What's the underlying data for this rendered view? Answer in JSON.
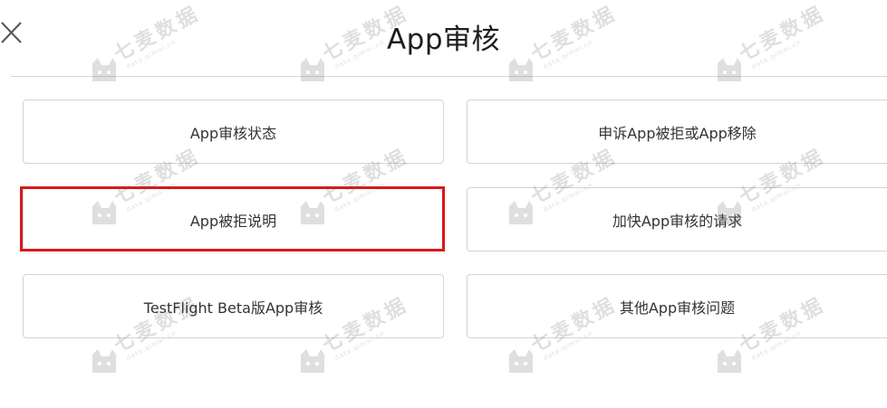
{
  "header": {
    "title": "App审核",
    "close_icon": "close-icon"
  },
  "options": [
    {
      "label": "App审核状态"
    },
    {
      "label": "申诉App被拒或App移除"
    },
    {
      "label": "App被拒说明"
    },
    {
      "label": "加快App审核的请求"
    },
    {
      "label": "TestFlight Beta版App审核"
    },
    {
      "label": "其他App审核问题"
    }
  ],
  "highlight_color": "#d9191c",
  "watermark": {
    "text": "七麦数据",
    "subtext": "data.qimai.cn",
    "icon": "cat-logo-icon"
  }
}
